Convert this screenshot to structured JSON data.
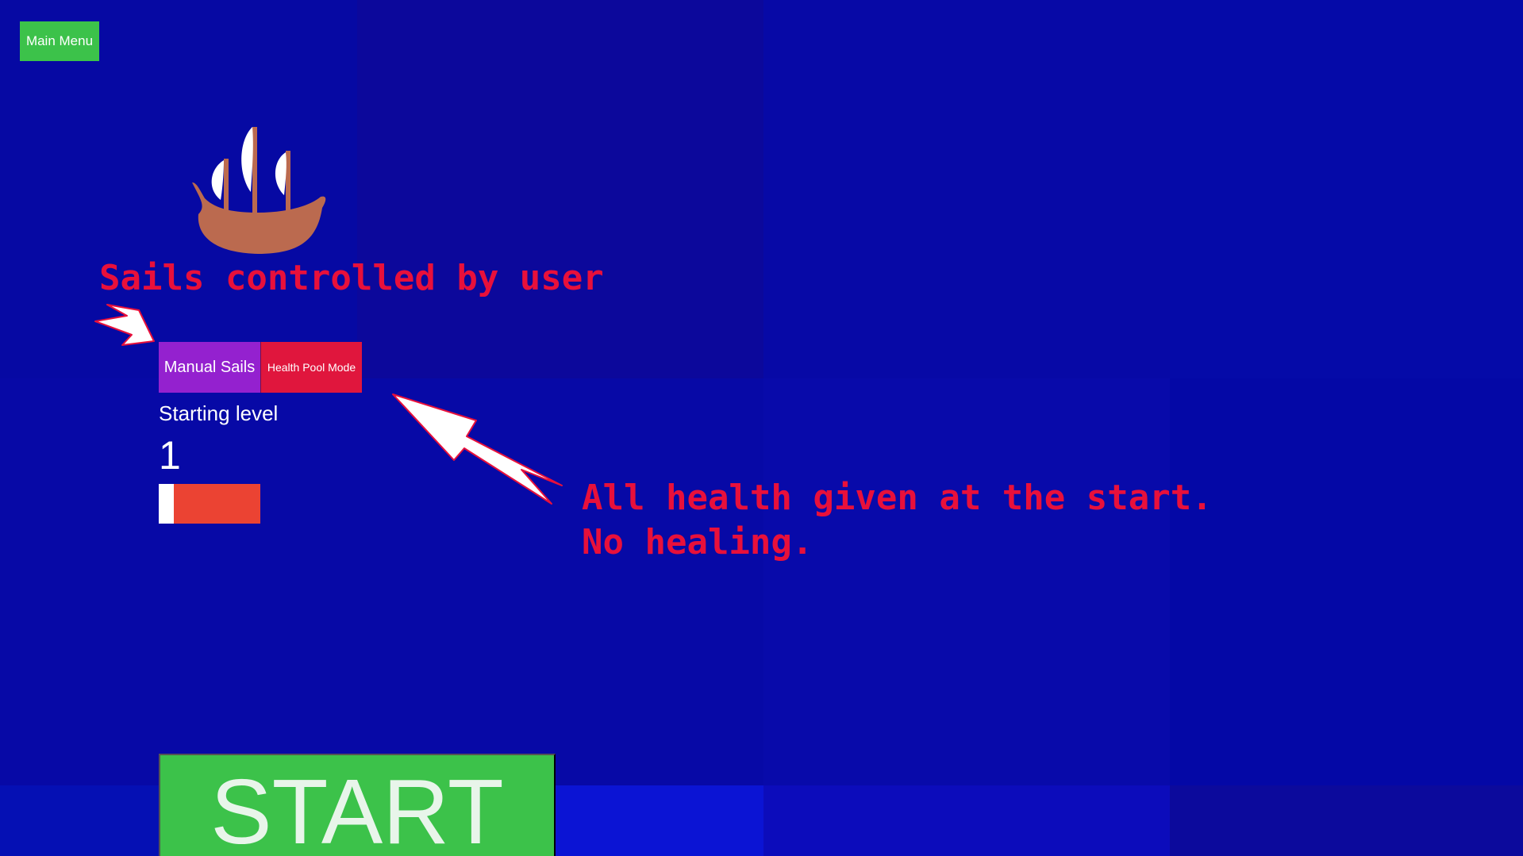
{
  "menu": {
    "main_menu_label": "Main Menu"
  },
  "annotations": {
    "sails": "Sails controlled by user",
    "health_line1": "All health given at the start.",
    "health_line2": "No healing."
  },
  "modes": {
    "manual_sails_label": "Manual Sails",
    "health_pool_label": "Health Pool Mode"
  },
  "level": {
    "label": "Starting level",
    "value": "1",
    "slider_fraction": 0.15
  },
  "start": {
    "label": "START"
  },
  "colors": {
    "background": "#0709a4",
    "green_button": "#3cc24a",
    "manual_sails": "#9421cf",
    "health_pool": "#e0163d",
    "annotation_text": "#e8103b",
    "slider_track": "#eb4333"
  },
  "icons": [
    "ship-icon",
    "arrow-icon"
  ]
}
